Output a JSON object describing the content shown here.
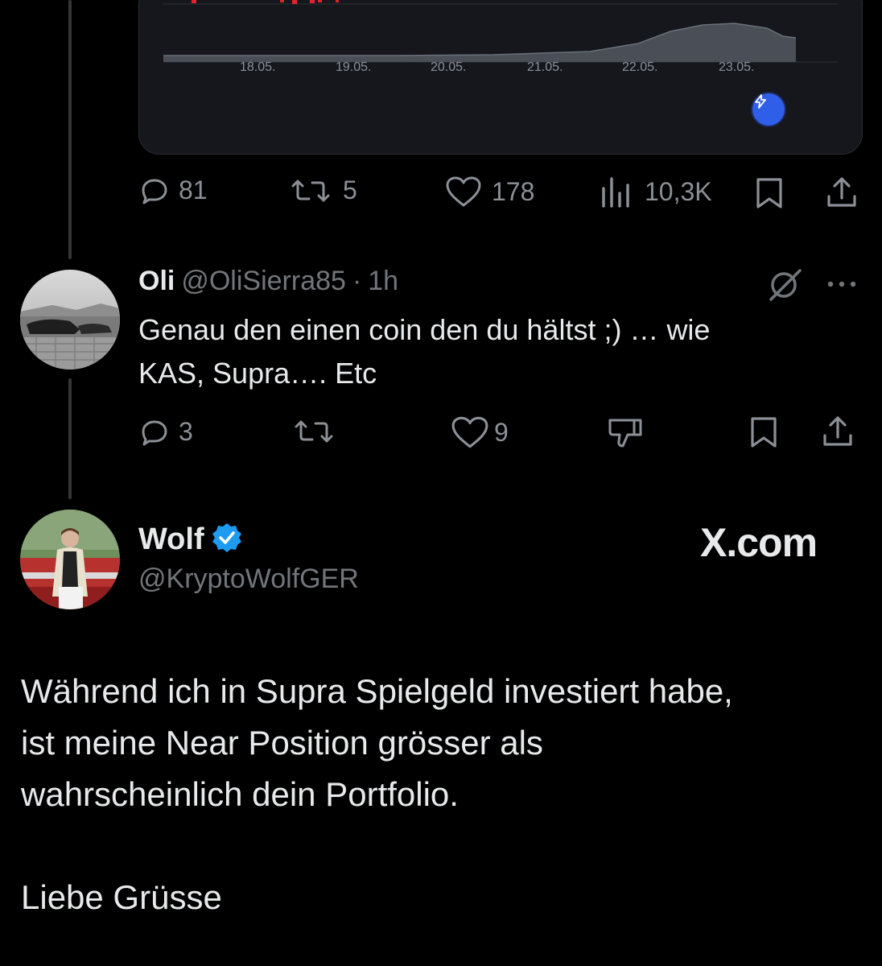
{
  "chart_data": {
    "type": "area",
    "x_tick_labels": [
      "18.05.",
      "19.05.",
      "20.05.",
      "21.05.",
      "22.05.",
      "23.05."
    ],
    "title": "",
    "xlabel": "",
    "ylabel": "",
    "grid": false
  },
  "colors": {
    "background": "#000000",
    "card": "#15171c",
    "muted": "#71767b",
    "text": "#e7e9ea",
    "verified": "#1d9bf0",
    "badge": "#2f5ee8"
  },
  "parent_post": {
    "actions": {
      "replies": "81",
      "reposts": "5",
      "likes": "178",
      "views": "10,3K"
    },
    "icons": [
      "reply-icon",
      "repost-icon",
      "like-icon",
      "views-icon",
      "bookmark-icon",
      "share-icon"
    ]
  },
  "reply": {
    "name": "Oli",
    "handle": "@OliSierra85",
    "separator": "·",
    "time": "1h",
    "text_line1": "Genau den einen coin den du hältst ;) … wie",
    "text_line2": "KAS, Supra…. Etc",
    "actions": {
      "replies": "3",
      "likes": "9"
    },
    "icons": [
      "grok-icon",
      "more-icon",
      "reply-icon",
      "repost-icon",
      "like-icon",
      "dislike-icon",
      "bookmark-icon",
      "share-icon"
    ]
  },
  "main_post": {
    "name": "Wolf",
    "handle": "@KryptoWolfGER",
    "verified": true,
    "brand": "X.com",
    "text_line1": "Während ich in Supra Spielgeld investiert habe,",
    "text_line2": "ist meine Near Position grösser als",
    "text_line3": "wahrscheinlich dein Portfolio.",
    "text_line4": "Liebe Grüsse"
  }
}
